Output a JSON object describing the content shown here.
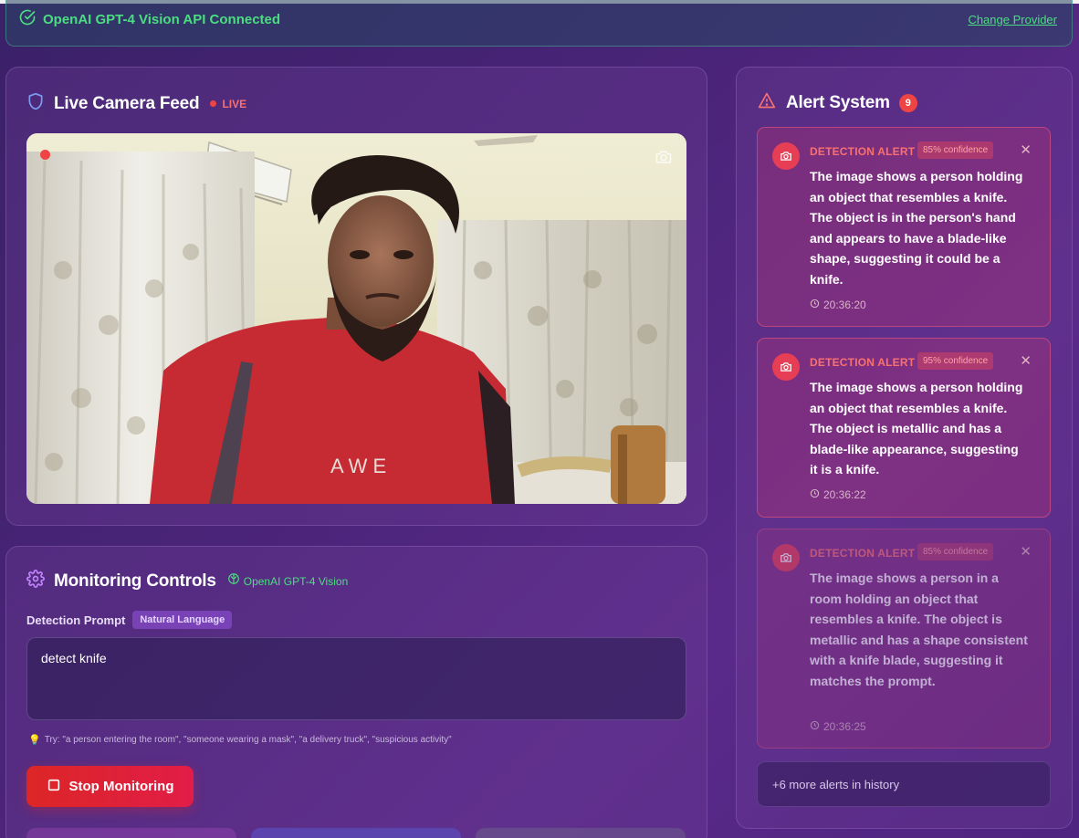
{
  "status_bar": {
    "text": "OpenAI GPT-4 Vision API Connected",
    "change_provider": "Change Provider"
  },
  "camera": {
    "title": "Live Camera Feed",
    "live_label": "LIVE",
    "shirt_text": "A W E"
  },
  "controls": {
    "title": "Monitoring Controls",
    "provider": "OpenAI GPT-4 Vision",
    "prompt_label": "Detection Prompt",
    "prompt_badge": "Natural Language",
    "prompt_value": "detect knife",
    "hint": "Try: \"a person entering the room\", \"someone wearing a mask\", \"a delivery truck\", \"suspicious activity\"",
    "stop_button": "Stop Monitoring"
  },
  "alerts": {
    "title": "Alert System",
    "count": "9",
    "items": [
      {
        "title": "DETECTION ALERT",
        "confidence": "85% confidence",
        "description": "The image shows a person holding an object that resembles a knife. The object is in the person's hand and appears to have a blade-like shape, suggesting it could be a knife.",
        "time": "20:36:20"
      },
      {
        "title": "DETECTION ALERT",
        "confidence": "95% confidence",
        "description": "The image shows a person holding an object that resembles a knife. The object is metallic and has a blade-like appearance, suggesting it is a knife.",
        "time": "20:36:22"
      },
      {
        "title": "DETECTION ALERT",
        "confidence": "85% confidence",
        "description": "The image shows a person in a room holding an object that resembles a knife. The object is metallic and has a shape consistent with a knife blade, suggesting it matches the prompt.",
        "time": "20:36:25"
      }
    ],
    "more": "+6 more alerts in history"
  },
  "colors": {
    "accent_green": "#4ade80",
    "alert_red": "#ef4444",
    "stop_red": "#dc2626"
  }
}
